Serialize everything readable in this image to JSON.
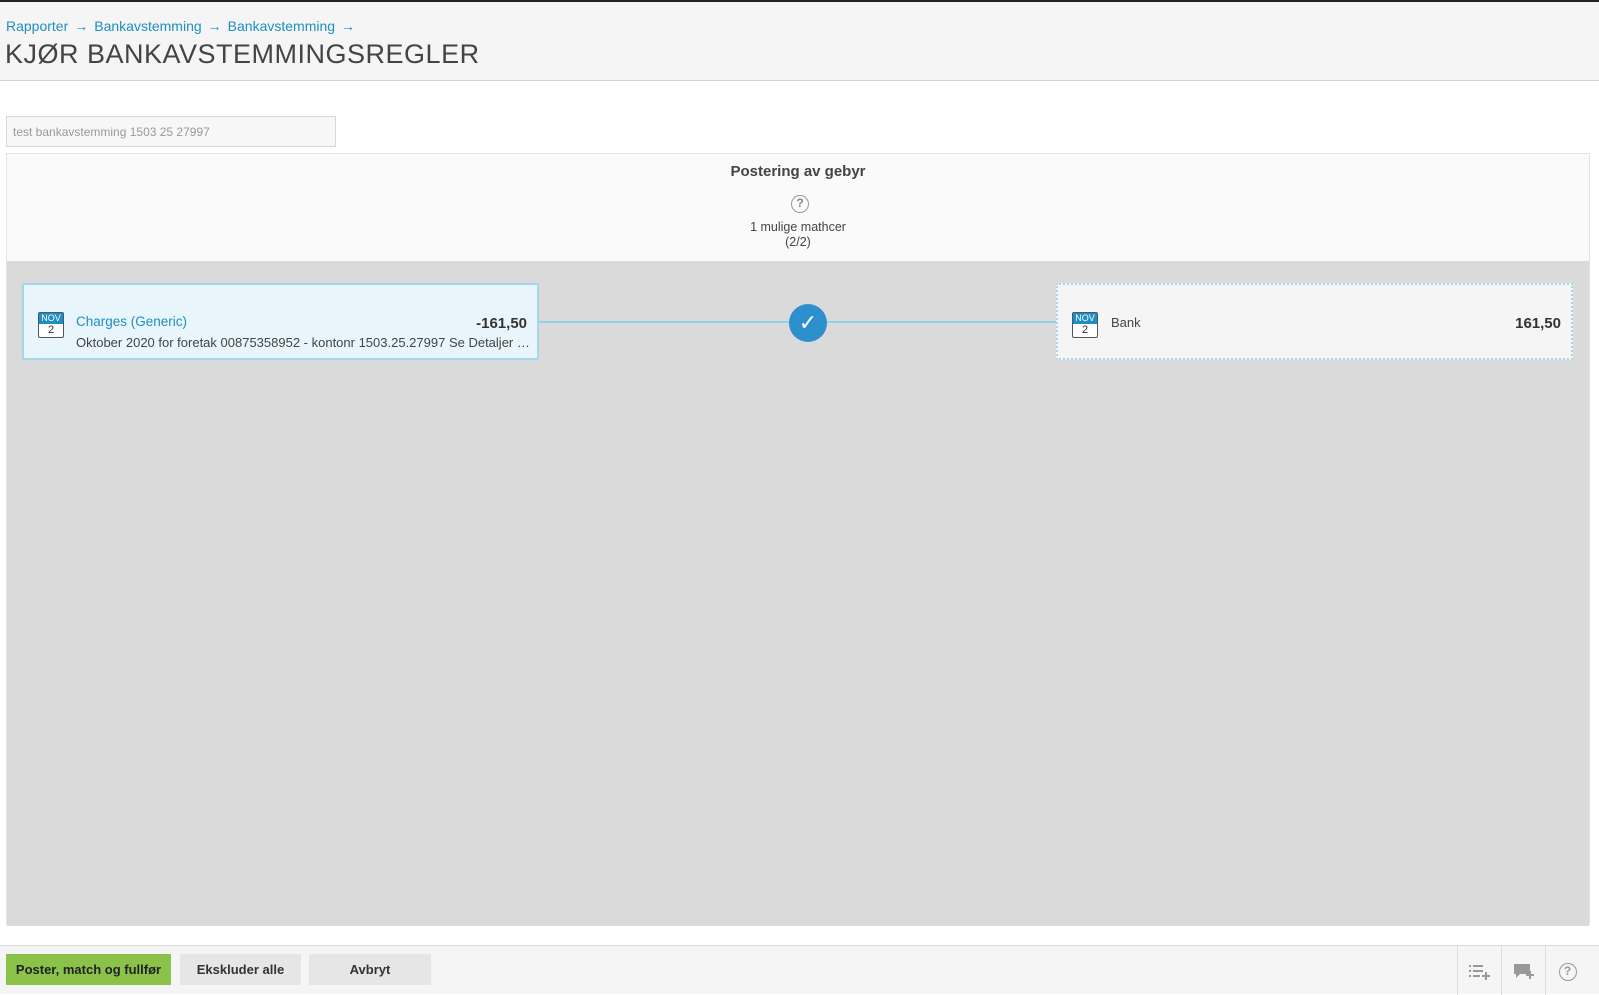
{
  "breadcrumb": {
    "items": [
      "Rapporter",
      "Bankavstemming",
      "Bankavstemming"
    ],
    "separator": "→"
  },
  "page": {
    "title": "KJØR BANKAVSTEMMINGSREGLER"
  },
  "reconciliation_name": {
    "value": "test bankavstemming 1503 25 27997"
  },
  "rule": {
    "title": "Postering av gebyr",
    "help_glyph": "?",
    "matches_label": "1 mulige mathcer",
    "matches_counter": "(2/2)"
  },
  "transaction_left": {
    "month": "NOV",
    "day": "2",
    "title": "Charges (Generic)",
    "description": "Oktober 2020 for foretak 00875358952 - kontonr 1503.25.27997 Se Detaljer på Nettbanken",
    "amount": "-161,50"
  },
  "transaction_right": {
    "month": "NOV",
    "day": "2",
    "label": "Bank",
    "amount": "161,50"
  },
  "match_status": {
    "icon": "check-icon",
    "glyph": "✓"
  },
  "footer": {
    "primary_label": "Poster, match og fullfør",
    "exclude_label": "Ekskluder alle",
    "cancel_label": "Avbryt",
    "tools": [
      {
        "icon": "list-add-icon",
        "glyph": "☰+"
      },
      {
        "icon": "comment-add-icon",
        "glyph": "💬"
      },
      {
        "icon": "help-icon",
        "glyph": "?"
      }
    ]
  },
  "colors": {
    "accent": "#1e8fc4",
    "primary_button": "#8bc34a",
    "check": "#2e8fcd"
  }
}
